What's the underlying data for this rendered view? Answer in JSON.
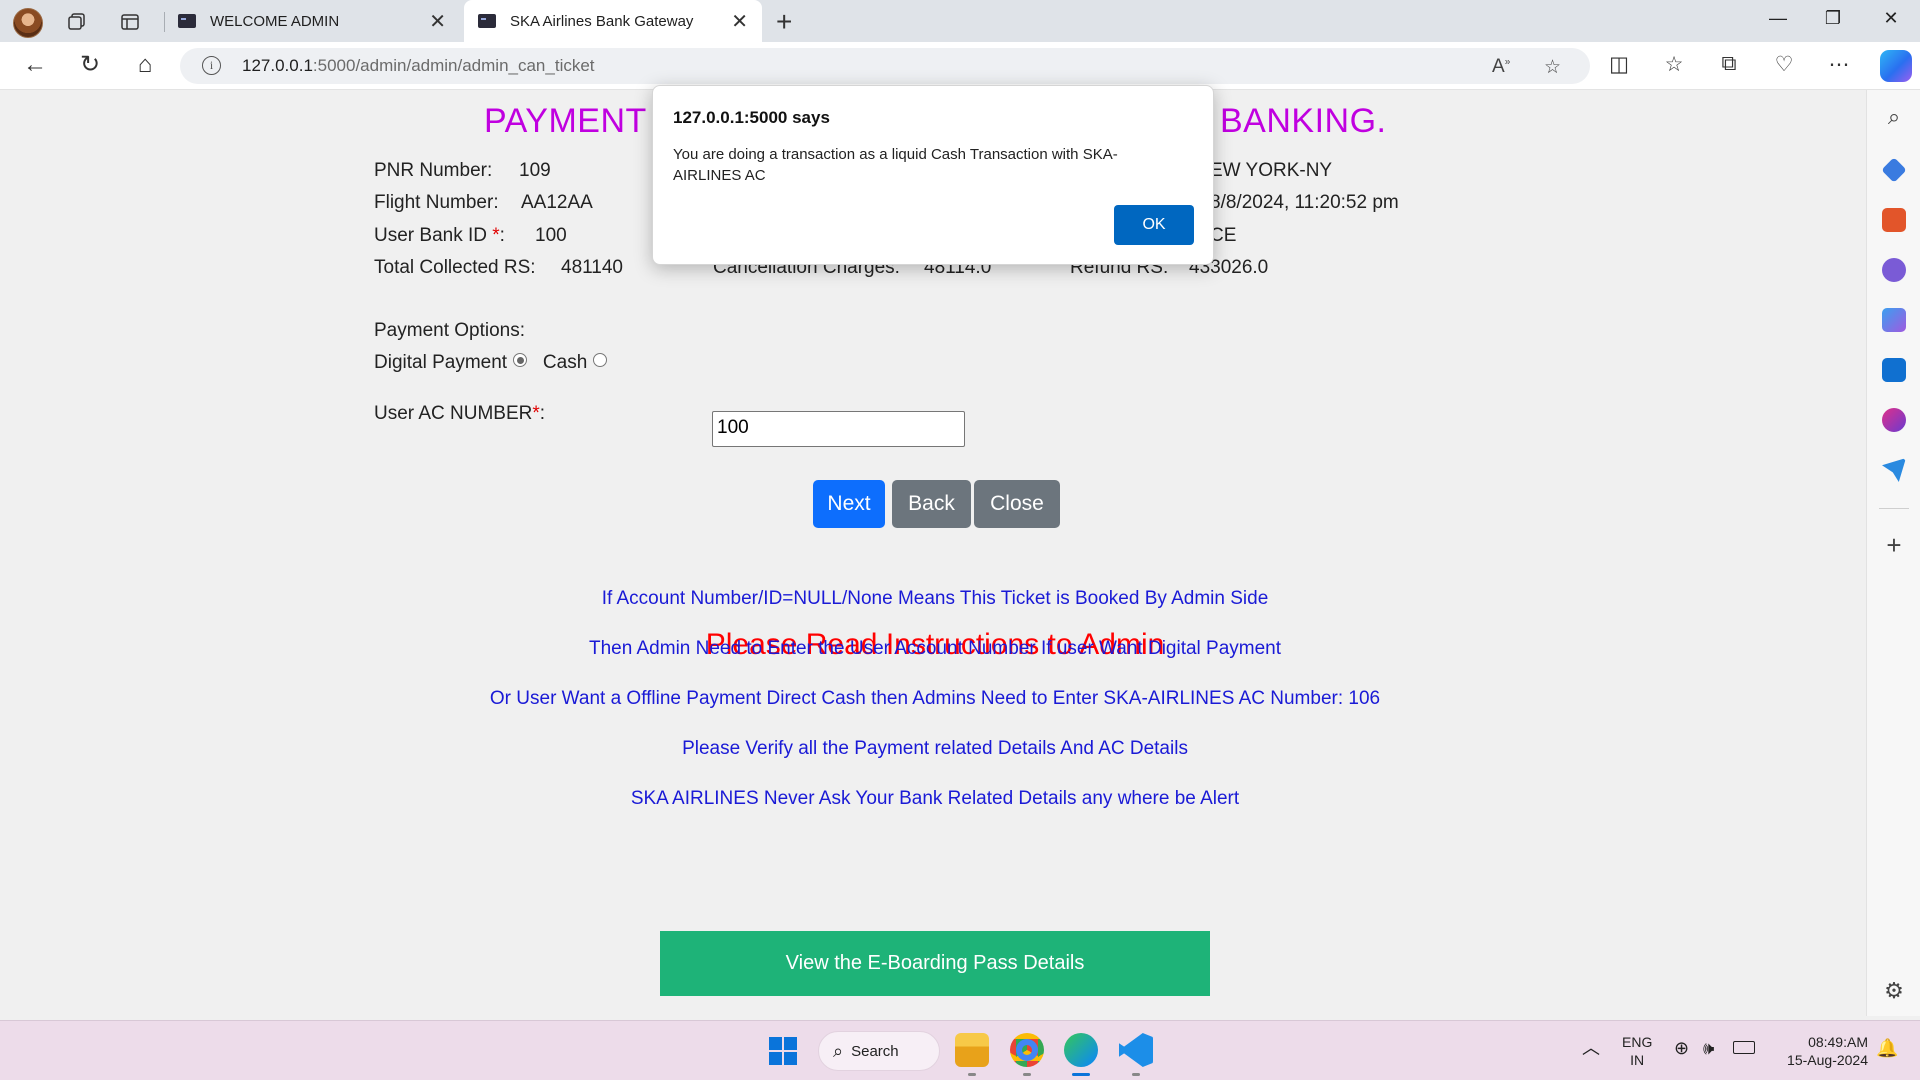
{
  "browser": {
    "tabs": [
      {
        "label": "WELCOME ADMIN",
        "active": false
      },
      {
        "label": "SKA Airlines Bank Gateway",
        "active": true
      }
    ],
    "url_host": "127.0.0.1",
    "url_path": ":5000/admin/admin/admin_can_ticket"
  },
  "page": {
    "heading_left": "PAYMENT",
    "heading_right": "BANKING.",
    "pnr_label": "PNR Number:",
    "pnr_value": "109",
    "flight_label": "Flight Number:",
    "flight_value": "AA12AA",
    "bank_id_label": "User Bank ID",
    "bank_id_value": "100",
    "total_label": "Total Collected RS:",
    "total_value": "481140",
    "cancel_label": "Cancellation Charges:",
    "cancel_value": "48114.0",
    "refund_label": "Refund RS:",
    "refund_value": "433026.0",
    "dest_partial": "EW YORK-NY",
    "date_partial": "8/8/2024, 11:20:52 pm",
    "class_partial": "CE",
    "payment_options_label": "Payment Options:",
    "digital_label": "Digital Payment",
    "cash_label": "Cash",
    "ac_label": "User AC NUMBER",
    "ac_value": "100",
    "buttons": {
      "next": "Next",
      "back": "Back",
      "close": "Close"
    },
    "instructions_title": "Please Read Instructions to Admin",
    "instructions": [
      "If Account Number/ID=NULL/None Means This Ticket is Booked By Admin Side",
      "Then Admin Need to Enter the User Account Number If user Want Digital Payment",
      "Or User Want a Offline Payment Direct Cash then Admins Need to Enter SKA-AIRLINES AC Number: 106",
      "Please Verify all the Payment related Details And AC Details",
      "SKA AIRLINES Never Ask Your Bank Related Details any where be Alert"
    ],
    "eboarding_button": "View the E-Boarding Pass Details"
  },
  "dialog": {
    "title": "127.0.0.1:5000 says",
    "message": "You are doing a transaction as a liquid Cash Transaction with SKA-AIRLINES AC",
    "ok": "OK"
  },
  "taskbar": {
    "search_label": "Search",
    "lang_line1": "ENG",
    "lang_line2": "IN",
    "time": "08:49:AM",
    "date": "15-Aug-2024"
  },
  "colors": {
    "heading": "#c000e0",
    "instruction_title": "#ff0000",
    "instruction_text": "#1a1ad6",
    "next_button": "#0d6efd",
    "secondary_button": "#6c757d",
    "eboarding_button": "#1eb378",
    "dialog_ok": "#0067c0"
  }
}
